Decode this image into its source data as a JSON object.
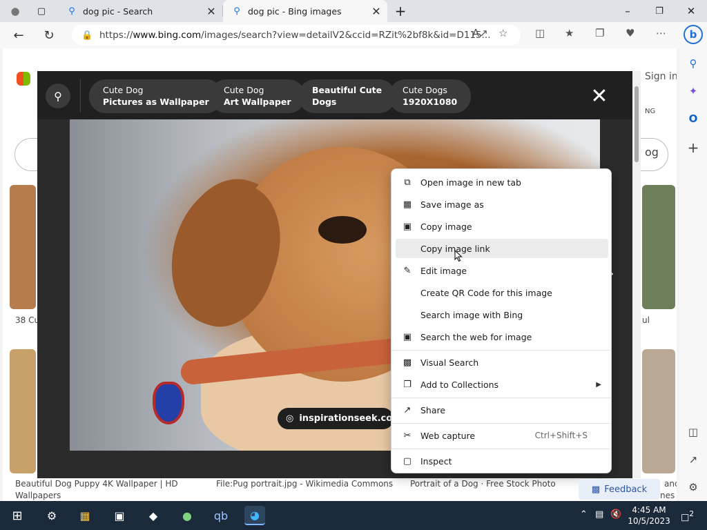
{
  "browser": {
    "tabs": [
      {
        "title": "dog pic - Search"
      },
      {
        "title": "dog pic - Bing images"
      }
    ],
    "new_tab": "+",
    "address": {
      "scheme": "https://",
      "host": "www.bing.com",
      "rest": "/images/search?view=detailV2&ccid=RZit%2bf8k&id=D115..."
    }
  },
  "page": {
    "sign_in": "Sign in",
    "captions": [
      "38 Cu",
      "Beautiful Dog Puppy 4K Wallpaper | HD",
      "Wallpapers",
      "File:Pug portrait.jpg - Wikimedia Commons",
      "Portrait of a Dog · Free Stock Photo",
      "and",
      "nes",
      "ul",
      "NG",
      "og"
    ],
    "feedback": "Feedback"
  },
  "viewer": {
    "chips": [
      {
        "line1": "Cute Dog",
        "line2": "Pictures as Wallpaper"
      },
      {
        "line1": "Cute Dog",
        "line2": "Art Wallpaper"
      },
      {
        "line1": "Beautiful Cute",
        "line2": "Dogs"
      },
      {
        "line1": "Cute Dogs",
        "line2": "1920X1080"
      }
    ],
    "source_badge": "inspirationseek.com"
  },
  "context_menu": {
    "items": [
      {
        "label": "Open image in new tab",
        "icon": "new-tab-icon"
      },
      {
        "label": "Save image as",
        "icon": "save-image-icon"
      },
      {
        "label": "Copy image",
        "icon": "copy-image-icon"
      },
      {
        "label": "Copy image link",
        "icon": ""
      },
      {
        "label": "Edit image",
        "icon": "edit-image-icon"
      },
      {
        "label": "Create QR Code for this image",
        "icon": ""
      },
      {
        "label": "Search image with Bing",
        "icon": ""
      },
      {
        "label": "Search the web for image",
        "icon": "search-web-icon"
      },
      {
        "label": "Visual Search",
        "icon": "visual-search-icon"
      },
      {
        "label": "Add to Collections",
        "icon": "collections-icon"
      },
      {
        "label": "Share",
        "icon": "share-icon"
      },
      {
        "label": "Web capture",
        "icon": "web-capture-icon",
        "shortcut": "Ctrl+Shift+S"
      },
      {
        "label": "Inspect",
        "icon": "inspect-icon"
      }
    ]
  },
  "taskbar": {
    "time": "4:45 AM",
    "date": "10/5/2023",
    "notification_count": "2"
  }
}
